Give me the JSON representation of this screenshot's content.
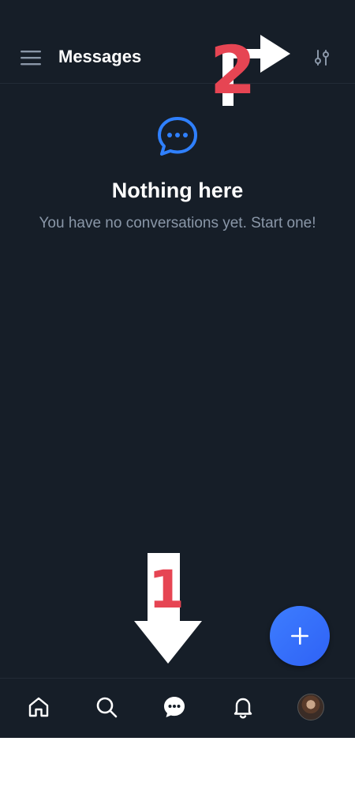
{
  "header": {
    "title": "Messages",
    "menu_icon": "hamburger-menu-icon",
    "filter_icon": "sliders-filter-icon"
  },
  "empty_state": {
    "icon": "chat-bubble-icon",
    "title": "Nothing here",
    "subtitle": "You have no conversations yet. Start one!"
  },
  "fab": {
    "icon": "plus-icon"
  },
  "bottom_nav": {
    "items": [
      {
        "icon": "home-icon"
      },
      {
        "icon": "search-icon"
      },
      {
        "icon": "messages-icon",
        "active": true
      },
      {
        "icon": "bell-icon"
      },
      {
        "icon": "avatar"
      }
    ]
  },
  "annotations": {
    "label_1": "1",
    "label_2": "2"
  },
  "colors": {
    "background": "#161e28",
    "accent": "#2f80ff",
    "annotation": "#e64553",
    "text_muted": "#8a97a8"
  }
}
